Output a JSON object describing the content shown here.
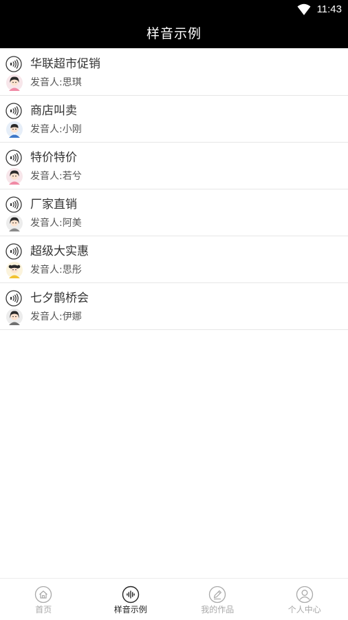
{
  "status_bar": {
    "time": "11:43"
  },
  "header": {
    "title": "样音示例"
  },
  "samples": [
    {
      "title": "华联超市促销",
      "speaker": "发音人:思琪",
      "avatar": "girl-avatar-icon"
    },
    {
      "title": "商店叫卖",
      "speaker": "发音人:小刚",
      "avatar": "boy-avatar-icon"
    },
    {
      "title": "特价特价",
      "speaker": "发音人:若兮",
      "avatar": "girl-avatar-icon"
    },
    {
      "title": "厂家直销",
      "speaker": "发音人:阿美",
      "avatar": "girl-avatar-icon"
    },
    {
      "title": "超级大实惠",
      "speaker": "发音人:思彤",
      "avatar": "child-avatar-icon"
    },
    {
      "title": "七夕鹊桥会",
      "speaker": "发音人:伊娜",
      "avatar": "girl-avatar-icon"
    }
  ],
  "tabs": [
    {
      "label": "首页",
      "icon": "home-icon",
      "active": false
    },
    {
      "label": "样音示例",
      "icon": "waveform-icon",
      "active": true
    },
    {
      "label": "我的作品",
      "icon": "pencil-icon",
      "active": false
    },
    {
      "label": "个人中心",
      "icon": "user-icon",
      "active": false
    }
  ],
  "colors": {
    "header_bg": "#000000",
    "active_tab": "#222222",
    "inactive_tab": "#a8a8a8",
    "divider": "#e6e6e6"
  }
}
